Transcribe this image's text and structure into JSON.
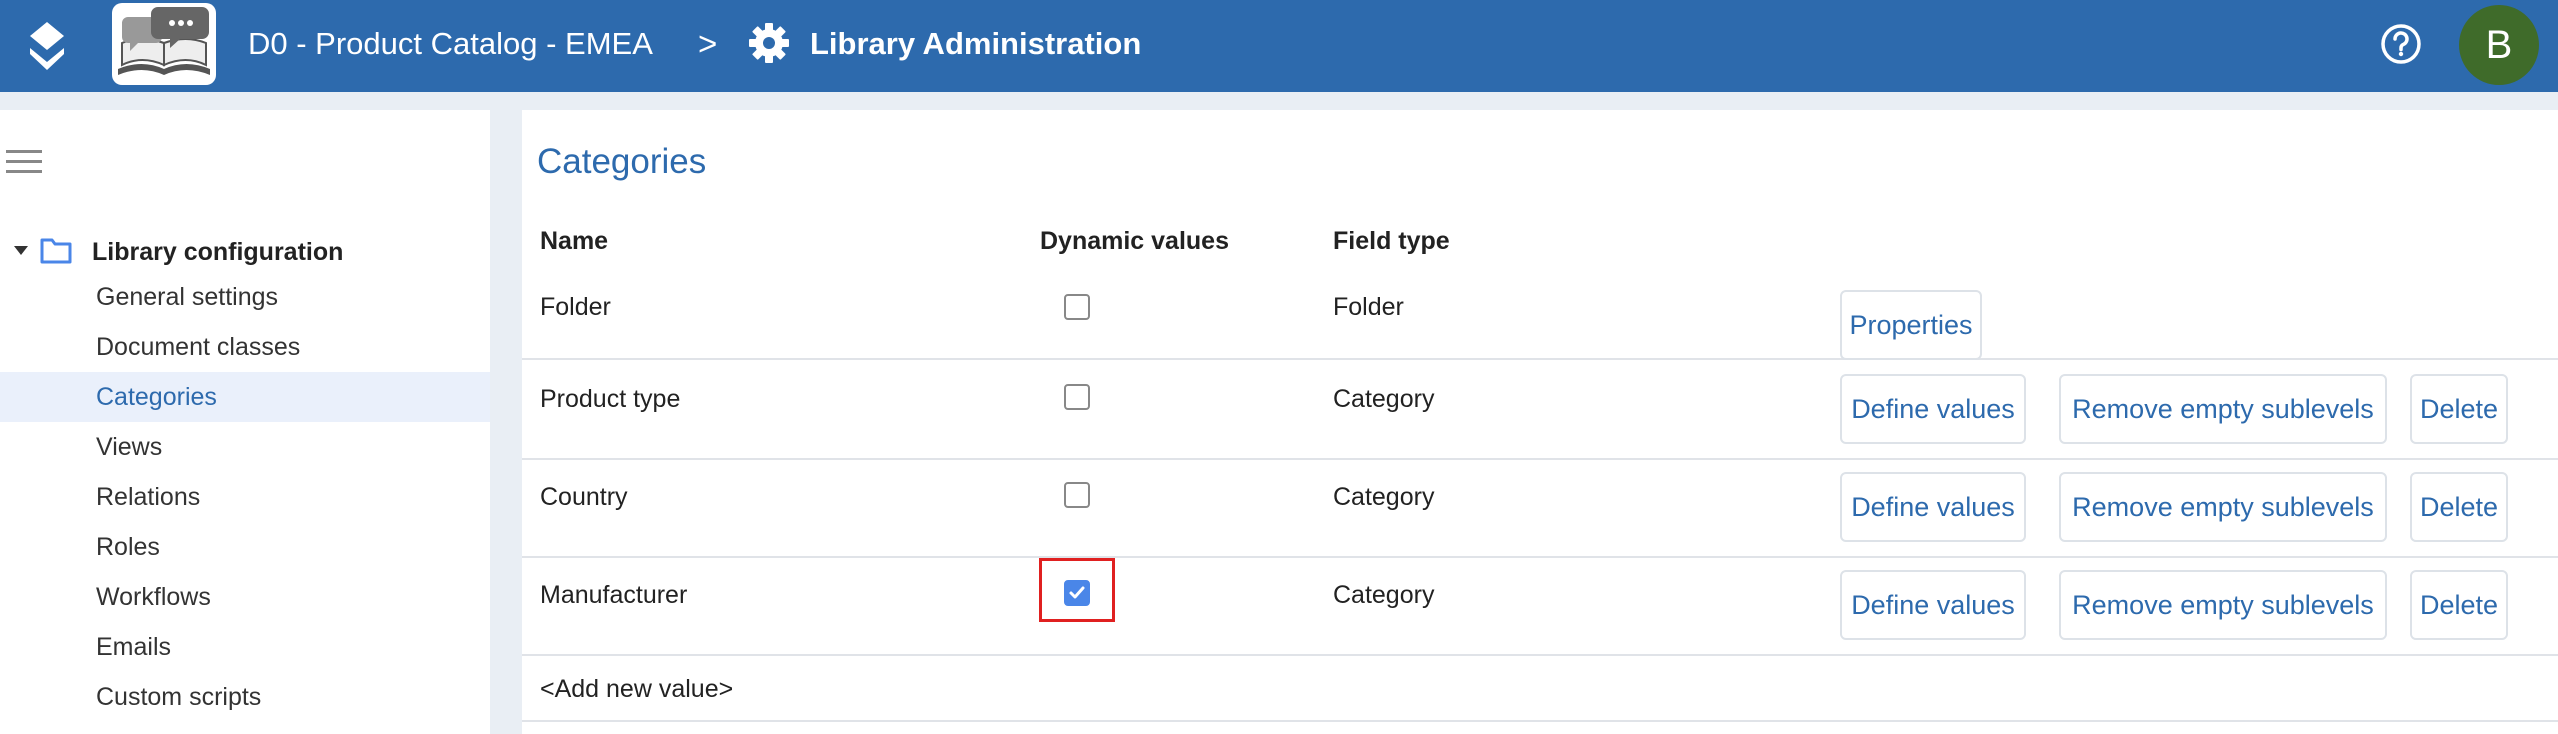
{
  "header": {
    "library_name": "D0 - Product Catalog - EMEA",
    "separator": ">",
    "admin_title": "Library Administration",
    "avatar_initial": "B",
    "brand_color": "#2d6aad",
    "avatar_color": "#3f6b2a"
  },
  "sidebar": {
    "root_label": "Library configuration",
    "items": [
      {
        "label": "General settings",
        "active": false
      },
      {
        "label": "Document classes",
        "active": false
      },
      {
        "label": "Categories",
        "active": true
      },
      {
        "label": "Views",
        "active": false
      },
      {
        "label": "Relations",
        "active": false
      },
      {
        "label": "Roles",
        "active": false
      },
      {
        "label": "Workflows",
        "active": false
      },
      {
        "label": "Emails",
        "active": false
      },
      {
        "label": "Custom scripts",
        "active": false
      }
    ]
  },
  "main": {
    "title": "Categories",
    "columns": {
      "name": "Name",
      "dynamic": "Dynamic values",
      "field_type": "Field type"
    },
    "rows": [
      {
        "name": "Folder",
        "dynamic": false,
        "field_type": "Folder",
        "buttons": [
          "Properties"
        ]
      },
      {
        "name": "Product type",
        "dynamic": false,
        "field_type": "Category",
        "buttons": [
          "Define values",
          "Remove empty sublevels",
          "Delete"
        ]
      },
      {
        "name": "Country",
        "dynamic": false,
        "field_type": "Category",
        "buttons": [
          "Define values",
          "Remove empty sublevels",
          "Delete"
        ]
      },
      {
        "name": "Manufacturer",
        "dynamic": true,
        "field_type": "Category",
        "buttons": [
          "Define values",
          "Remove empty sublevels",
          "Delete"
        ],
        "highlighted": true
      }
    ],
    "add_new": "<Add new value>"
  }
}
